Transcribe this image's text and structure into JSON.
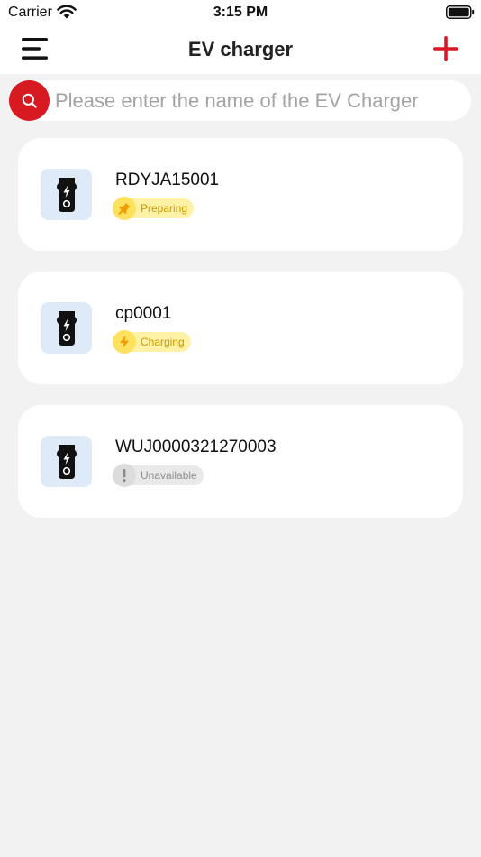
{
  "status_bar": {
    "carrier": "Carrier",
    "time": "3:15 PM"
  },
  "header": {
    "title": "EV charger",
    "menu_icon": "hamburger-menu-icon",
    "add_icon": "plus-icon"
  },
  "search": {
    "placeholder": "Please enter the name of the EV Charger",
    "value": "",
    "icon": "search-icon"
  },
  "colors": {
    "accent": "#d71a21",
    "background": "#f2f2f2",
    "card": "#ffffff",
    "icon_box": "#dfeaf8",
    "status_yellow_bg": "#fff2a6",
    "status_yellow_text": "#c99a00",
    "status_gray_bg": "#e9e9e9",
    "status_gray_text": "#8e8e8e"
  },
  "chargers": [
    {
      "name": "RDYJA15001",
      "status": "Preparing",
      "status_icon": "pin-icon"
    },
    {
      "name": "cp0001",
      "status": "Charging",
      "status_icon": "lightning-icon"
    },
    {
      "name": "WUJ0000321270003",
      "status": "Unavailable",
      "status_icon": "exclamation-icon"
    }
  ]
}
